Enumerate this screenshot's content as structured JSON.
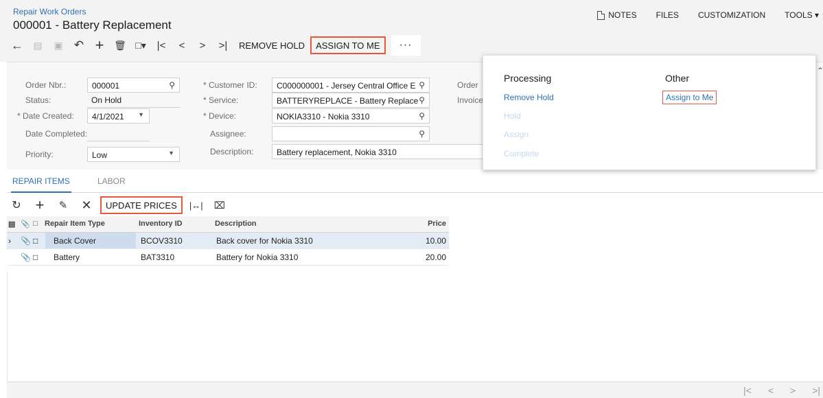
{
  "breadcrumb": "Repair Work Orders",
  "title": "000001 - Battery Replacement",
  "topbar": {
    "notes": "NOTES",
    "files": "FILES",
    "customization": "CUSTOMIZATION",
    "tools": "TOOLS ▾"
  },
  "toolbar": {
    "remove_hold": "REMOVE HOLD",
    "assign_to_me": "ASSIGN TO ME",
    "more": "···"
  },
  "form": {
    "order_nbr_label": "Order Nbr.:",
    "order_nbr": "000001",
    "status_label": "Status:",
    "status": "On Hold",
    "date_created_label": "* Date Created:",
    "date_created": "4/1/2021",
    "date_completed_label": "Date Completed:",
    "date_completed": "",
    "priority_label": "Priority:",
    "priority": "Low",
    "customer_label": "* Customer ID:",
    "customer": "C000000001 - Jersey Central Office E",
    "service_label": "* Service:",
    "service": "BATTERYREPLACE - Battery Replace",
    "device_label": "* Device:",
    "device": "NOKIA3310 - Nokia 3310",
    "assignee_label": "Assignee:",
    "assignee": "",
    "description_label": "Description:",
    "description": "Battery replacement, Nokia 3310",
    "order_total_label": "Order",
    "invoice_label": "Invoice"
  },
  "tabs": [
    {
      "label": "REPAIR ITEMS"
    },
    {
      "label": "LABOR"
    }
  ],
  "gridbar": {
    "update_prices": "UPDATE PRICES"
  },
  "grid": {
    "headers": {
      "type": "Repair Item Type",
      "inventory": "Inventory ID",
      "description": "Description",
      "price": "Price"
    },
    "rows": [
      {
        "type": "Back Cover",
        "inventory": "BCOV3310",
        "description": "Back cover for Nokia 3310",
        "price": "10.00"
      },
      {
        "type": "Battery",
        "inventory": "BAT3310",
        "description": "Battery for Nokia 3310",
        "price": "20.00"
      }
    ]
  },
  "menu": {
    "processing_header": "Processing",
    "other_header": "Other",
    "processing": [
      {
        "label": "Remove Hold"
      },
      {
        "label": "Hold"
      },
      {
        "label": "Assign"
      },
      {
        "label": "Complete"
      }
    ],
    "other": [
      {
        "label": "Assign to Me"
      }
    ]
  },
  "colors": {
    "accent": "#2f6fb3",
    "highlight": "#e8573c",
    "disabled": "#c5d9ec"
  },
  "icons": [
    "back-arrow-icon",
    "copy-icon",
    "save-icon",
    "undo-icon",
    "add-icon",
    "delete-icon",
    "clipboard-icon",
    "first-icon",
    "prev-icon",
    "next-icon",
    "last-icon",
    "search-icon",
    "refresh-icon",
    "edit-icon",
    "close-icon",
    "fit-columns-icon",
    "excel-icon",
    "attachment-icon",
    "note-icon"
  ]
}
